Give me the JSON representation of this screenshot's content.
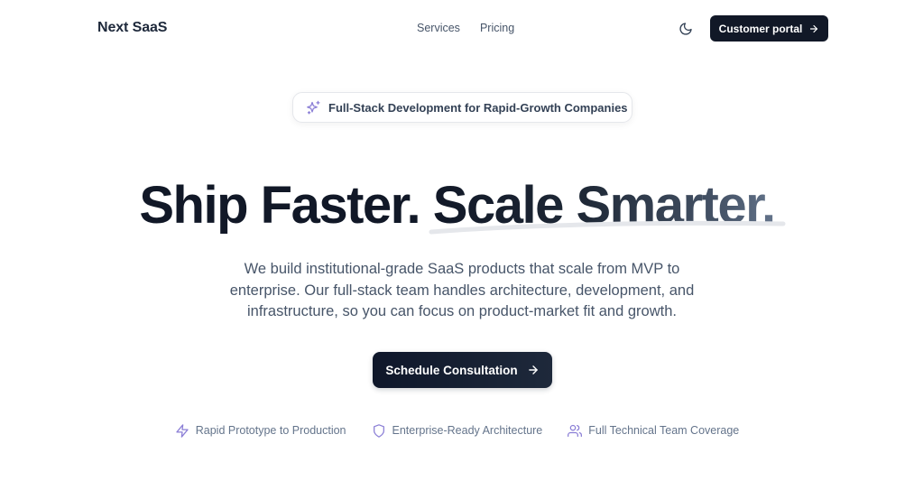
{
  "header": {
    "logo": "Next SaaS",
    "nav": [
      {
        "label": "Services"
      },
      {
        "label": "Pricing"
      }
    ],
    "theme_icon": "moon-icon",
    "portal_button": {
      "label": "Customer portal",
      "icon": "arrow-right-icon"
    }
  },
  "hero": {
    "badge": {
      "icon": "sparkles-icon",
      "text": "Full-Stack Development for Rapid-Growth Companies"
    },
    "headline_part1": "Ship Faster.",
    "headline_part2": "Scale Smarter.",
    "subtitle_lines": [
      "We build institutional-grade SaaS products that scale from MVP to",
      "enterprise. Our full-stack team handles architecture, development, and",
      "infrastructure, so you can focus on product-market fit and growth."
    ],
    "cta": {
      "label": "Schedule Consultation",
      "icon": "arrow-right-icon"
    }
  },
  "features": [
    {
      "icon": "zap-icon",
      "label": "Rapid Prototype to Production"
    },
    {
      "icon": "shield-icon",
      "label": "Enterprise-Ready Architecture"
    },
    {
      "icon": "users-icon",
      "label": "Full Technical Team Coverage"
    }
  ],
  "colors": {
    "primary_dark": "#111827",
    "text_muted": "#64748b",
    "accent_purple": "#8b7fd6"
  }
}
